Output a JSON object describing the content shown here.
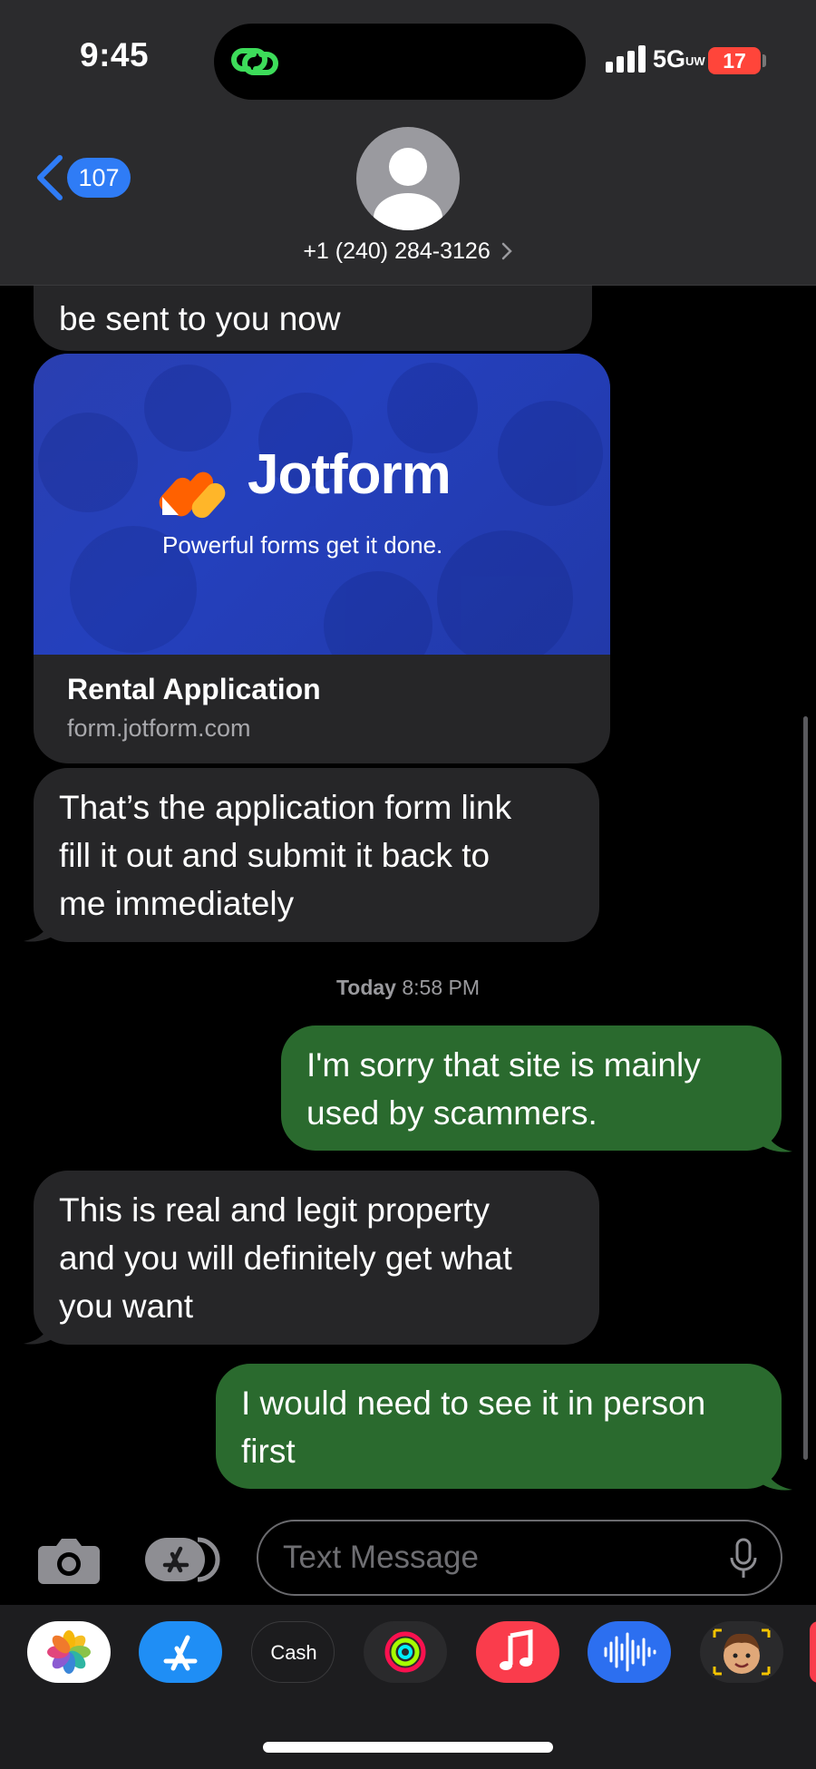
{
  "status_bar": {
    "time": "9:45",
    "network": "5G",
    "network_sub": "UW",
    "battery": "17"
  },
  "header": {
    "back_count": "107",
    "contact": "+1 (240) 284-3126"
  },
  "messages": [
    {
      "from": "them",
      "text": "be sent to you now"
    },
    {
      "from": "them",
      "type": "link",
      "title": "Rental Application",
      "domain": "form.jotform.com",
      "brand": "Jotform",
      "tagline": "Powerful forms get it done."
    },
    {
      "from": "them",
      "lines": [
        "That’s the application form link",
        "fill it out and submit it back to",
        "me immediately"
      ]
    },
    {
      "from": "me",
      "lines": [
        "I'm sorry that site is mainly",
        "used by scammers."
      ]
    },
    {
      "from": "them",
      "lines": [
        "This is real and legit property",
        "and you will definitely get what",
        "you want"
      ]
    },
    {
      "from": "me",
      "lines": [
        "I would need to see it in person",
        "first"
      ]
    }
  ],
  "timestamp": {
    "day": "Today",
    "time": "8:58 PM"
  },
  "compose": {
    "placeholder": "Text Message"
  },
  "dock": {
    "apps": [
      "photos",
      "app-store",
      "apple-cash",
      "activity",
      "music",
      "voice-memos",
      "memoji"
    ],
    "cash_label": "Cash"
  },
  "colors": {
    "sent": "#2a6a2e",
    "received": "#262628",
    "accent": "#2f7cf6"
  }
}
